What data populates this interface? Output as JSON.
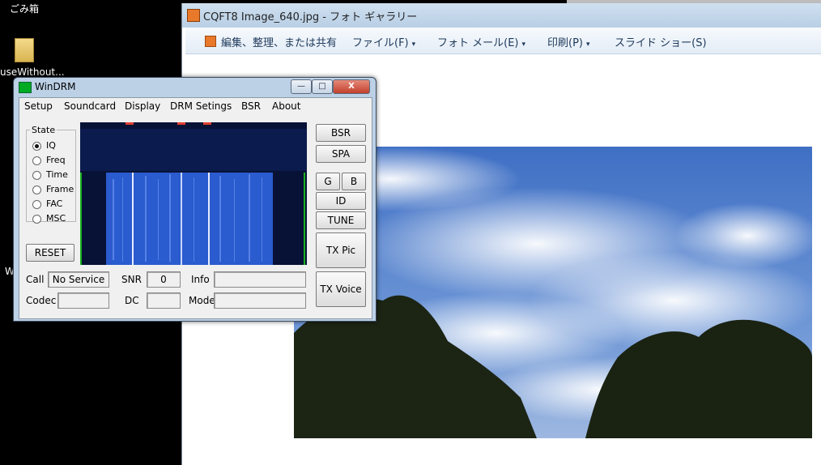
{
  "desktop": {
    "recycle_bin_label": "ごみ箱",
    "folder_label": "useWithout...",
    "partial_text_1": "W"
  },
  "gallery": {
    "title": "CQFT8 Image_640.jpg - フォト ギャラリー",
    "toolbar": {
      "share": "編集、整理、または共有",
      "file": "ファイル(F)",
      "photo_mail": "フォト メール(E)",
      "print": "印刷(P)",
      "slideshow": "スライド ショー(S)"
    }
  },
  "windrm": {
    "title": "WinDRM",
    "menu": [
      "Setup",
      "Soundcard",
      "Display",
      "DRM Setings",
      "BSR",
      "About"
    ],
    "state": {
      "legend": "State",
      "options": [
        "IQ",
        "Freq",
        "Time",
        "Frame",
        "FAC",
        "MSC"
      ],
      "selected": "IQ"
    },
    "reset_label": "RESET",
    "buttons": {
      "bsr": "BSR",
      "spa": "SPA",
      "g": "G",
      "b": "B",
      "id": "ID",
      "tune": "TUNE",
      "tx_pic": "TX Pic",
      "tx_voice": "TX Voice"
    },
    "fields": {
      "call_label": "Call",
      "call_value": "No Service",
      "snr_label": "SNR",
      "snr_value": "0",
      "info_label": "Info",
      "info_value": "",
      "codec_label": "Codec",
      "codec_value": "",
      "dc_label": "DC",
      "dc_value": "",
      "mode_label": "Mode",
      "mode_value": ""
    },
    "title_buttons": {
      "minimize": "—",
      "maximize": "□",
      "close": "X"
    }
  },
  "colors": {
    "spectrum_bg": "#091337",
    "spectrum_signal": "#2f62d8",
    "gallery_title_bg": "#c3d7ec"
  }
}
